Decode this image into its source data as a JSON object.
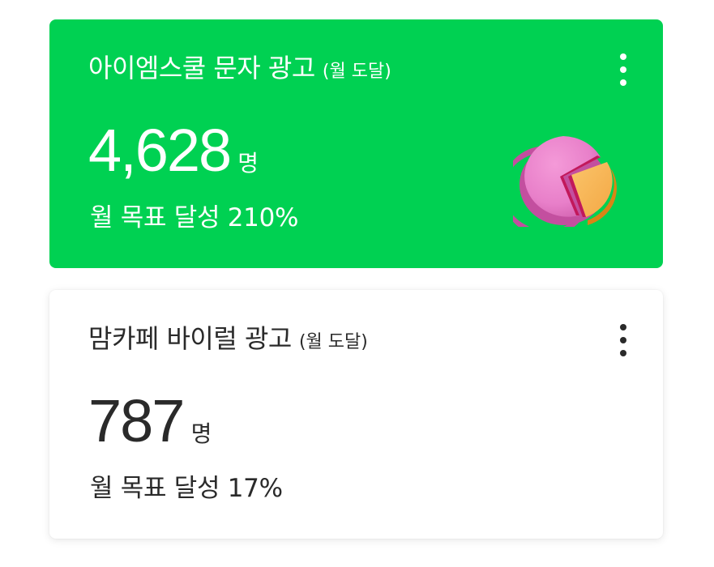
{
  "cards": [
    {
      "title": "아이엠스쿨 문자 광고",
      "subtitle": "(월 도달)",
      "metric": "4,628",
      "unit": "명",
      "goal_text": "월 목표 달성 210%",
      "goal_percent": 210,
      "icon": "pie-chart-icon",
      "background": "#00d152"
    },
    {
      "title": "맘카페 바이럴 광고",
      "subtitle": "(월 도달)",
      "metric": "787",
      "unit": "명",
      "goal_text": "월 목표 달성 17%",
      "goal_percent": 17,
      "background": "#ffffff"
    }
  ],
  "menu_icon": "more-vertical-icon"
}
